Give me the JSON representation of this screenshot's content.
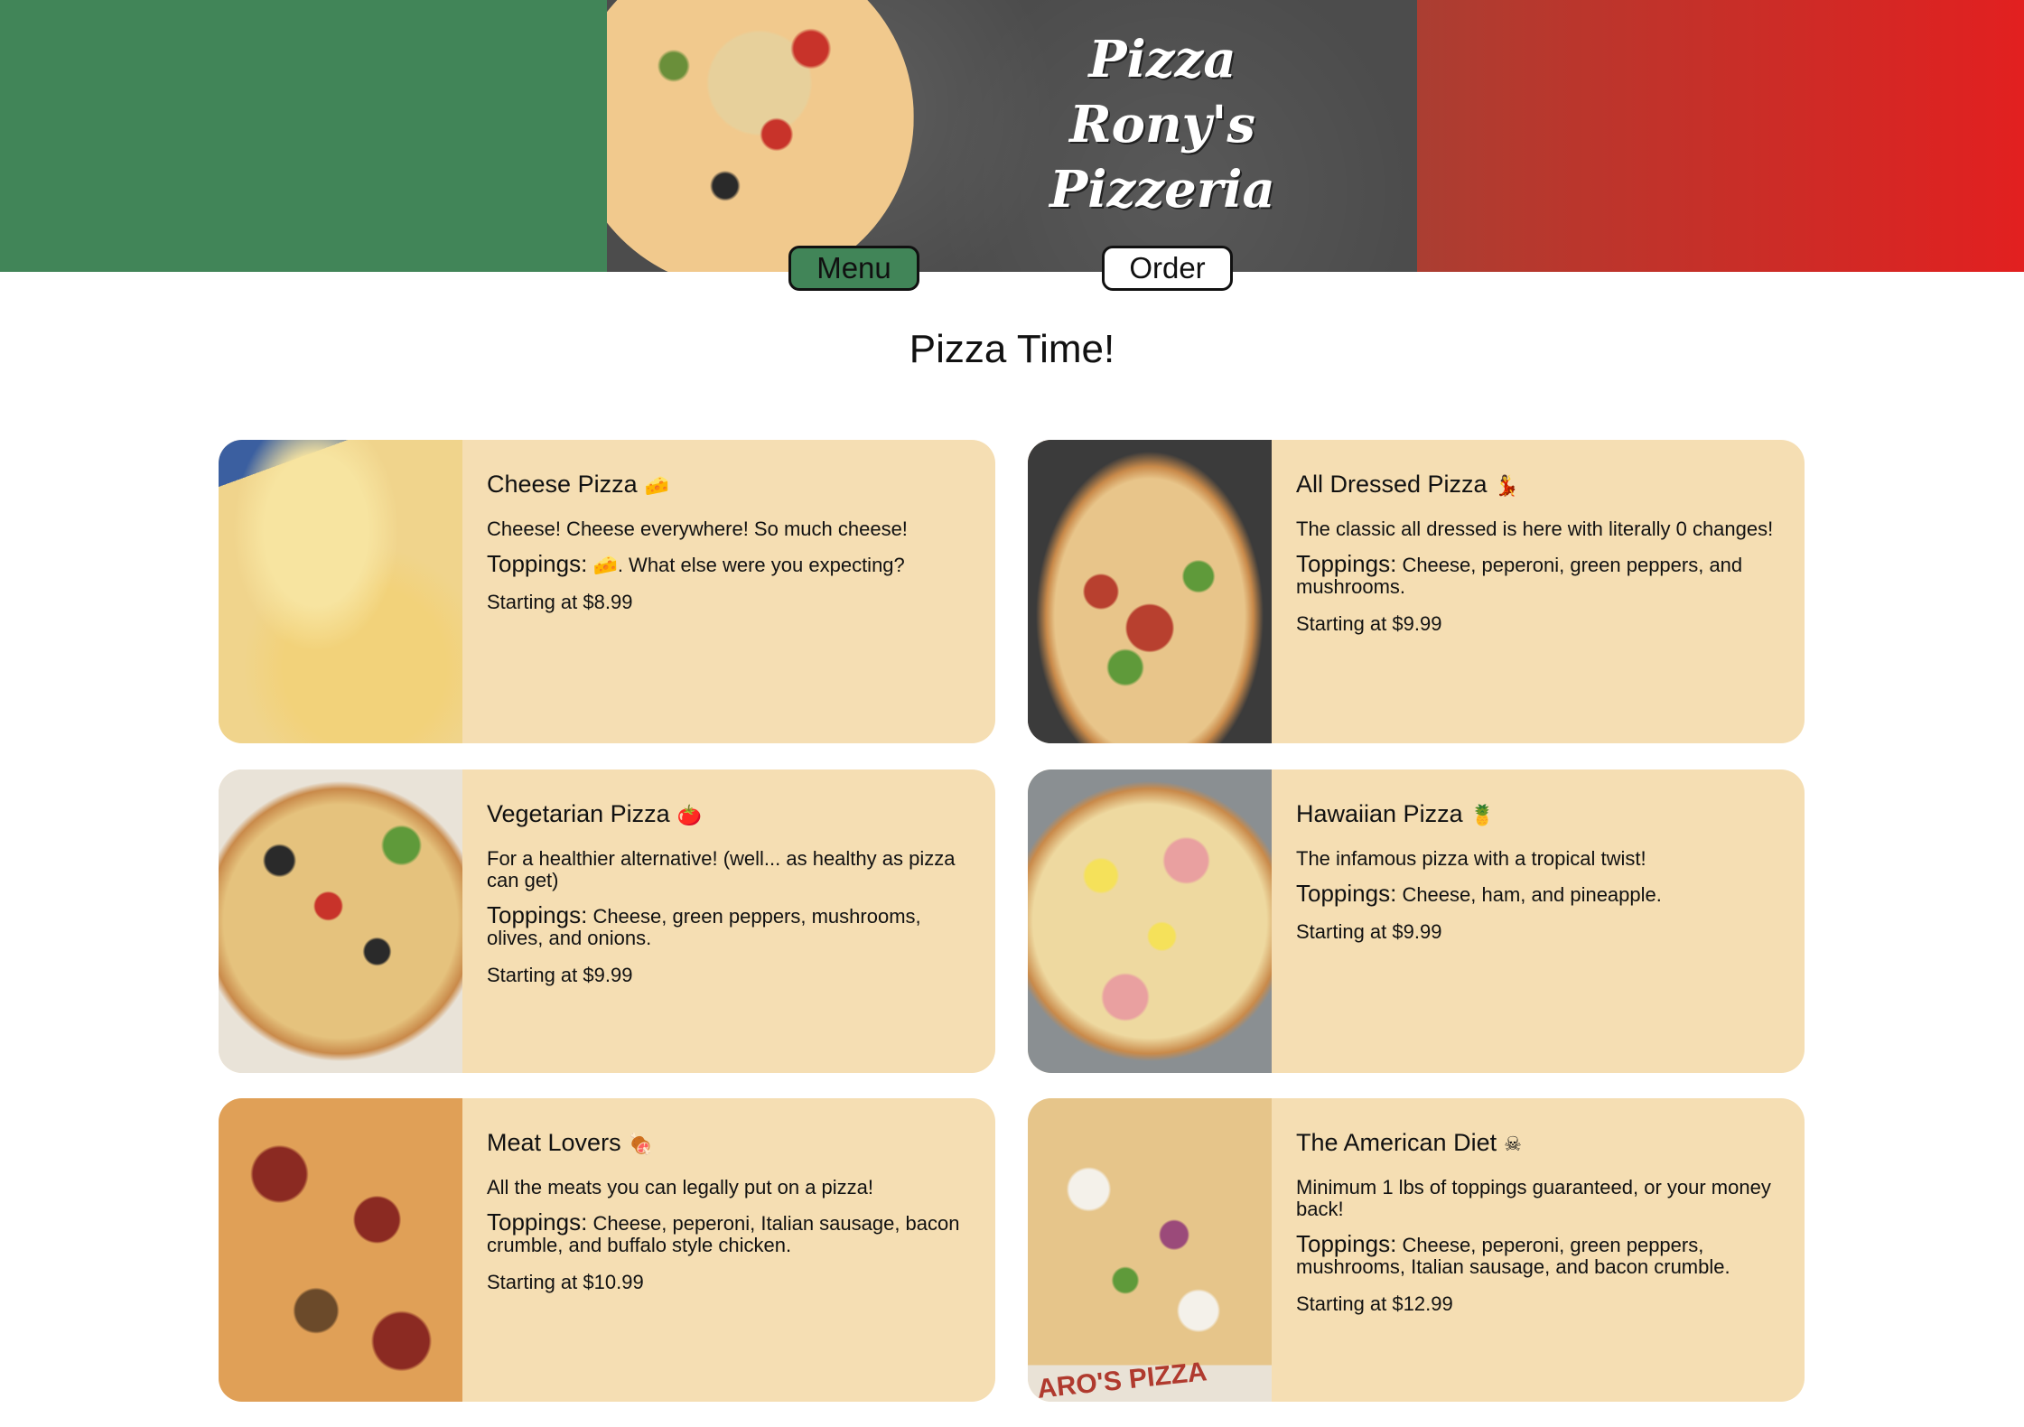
{
  "header": {
    "title_lines": [
      "Pizza",
      "Rony's",
      "Pizzeria"
    ],
    "nav": {
      "menu_label": "Menu",
      "order_label": "Order"
    }
  },
  "main": {
    "heading": "Pizza Time!",
    "toppings_label": "Toppings:",
    "pizzas": [
      {
        "name": "Cheese Pizza",
        "emoji": "🧀",
        "description": "Cheese! Cheese everywhere! So much cheese!",
        "toppings": "🧀. What else were you expecting?",
        "price": "Starting at $8.99"
      },
      {
        "name": "All Dressed Pizza",
        "emoji": "💃",
        "description": "The classic all dressed is here with literally 0 changes!",
        "toppings": "Cheese, peperoni, green peppers, and mushrooms.",
        "price": "Starting at $9.99"
      },
      {
        "name": "Vegetarian Pizza",
        "emoji": "🍅",
        "description": "For a healthier alternative! (well... as healthy as pizza can get)",
        "toppings": "Cheese, green peppers, mushrooms, olives, and onions.",
        "price": "Starting at $9.99"
      },
      {
        "name": "Hawaiian Pizza",
        "emoji": "🍍",
        "description": "The infamous pizza with a tropical twist!",
        "toppings": "Cheese, ham, and pineapple.",
        "price": "Starting at $9.99"
      },
      {
        "name": "Meat Lovers",
        "emoji": "🍖",
        "description": "All the meats you can legally put on a pizza!",
        "toppings": "Cheese, peperoni, Italian sausage, bacon crumble, and buffalo style chicken.",
        "price": "Starting at $10.99"
      },
      {
        "name": "The American Diet",
        "emoji": "☠",
        "description": "Minimum 1 lbs of toppings guaranteed, or your money back!",
        "toppings": "Cheese, peperoni, green peppers, mushrooms, Italian sausage, and bacon crumble.",
        "price": "Starting at $12.99"
      }
    ],
    "box_text": "ARO'S PIZZA"
  },
  "colors": {
    "green": "#418558",
    "red": "#e22020",
    "card": "#f5deb3"
  }
}
